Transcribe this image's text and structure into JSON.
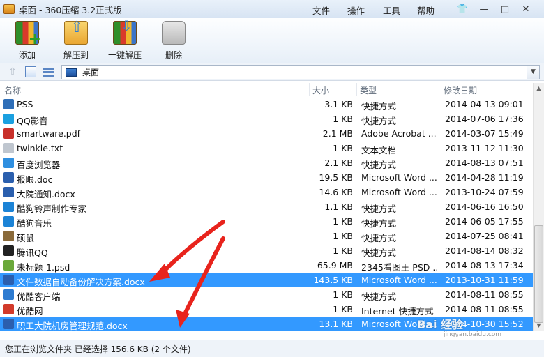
{
  "window": {
    "title": "桌面 - 360压缩 3.2正式版"
  },
  "menu": [
    "文件",
    "操作",
    "工具",
    "帮助"
  ],
  "window_controls": {
    "skin": "👕",
    "minimize": "—",
    "maximize": "□",
    "close": "✕"
  },
  "toolbar": {
    "add": "添加",
    "extract": "解压到",
    "one_click": "一键解压",
    "delete": "删除"
  },
  "address": {
    "current": "桌面",
    "back_glyph": "⇧",
    "dropdown_glyph": "▼"
  },
  "columns": {
    "name": "名称",
    "size": "大小",
    "type": "类型",
    "modified": "修改日期"
  },
  "files": [
    {
      "name": "PSS",
      "size": "3.1 KB",
      "type": "快捷方式",
      "modified": "2014-04-13 09:01",
      "icon": "pss-icon",
      "color": "#2f6fb8",
      "selected": false
    },
    {
      "name": "QQ影音",
      "size": "1 KB",
      "type": "快捷方式",
      "modified": "2014-07-06 17:36",
      "icon": "qqplayer-icon",
      "color": "#1aa0e0",
      "selected": false
    },
    {
      "name": "smartware.pdf",
      "size": "2.1 MB",
      "type": "Adobe Acrobat ...",
      "modified": "2014-03-07 15:49",
      "icon": "pdf-icon",
      "color": "#c8302a",
      "selected": false
    },
    {
      "name": "twinkle.txt",
      "size": "1 KB",
      "type": "文本文档",
      "modified": "2013-11-12 11:30",
      "icon": "text-file-icon",
      "color": "#bfc6cf",
      "selected": false
    },
    {
      "name": "百度浏览器",
      "size": "2.1 KB",
      "type": "快捷方式",
      "modified": "2014-08-13 07:51",
      "icon": "baidu-browser-icon",
      "color": "#2f8fe0",
      "selected": false
    },
    {
      "name": "报眼.doc",
      "size": "19.5 KB",
      "type": "Microsoft Word ...",
      "modified": "2014-04-28 11:19",
      "icon": "word-doc-icon",
      "color": "#2b5fae",
      "selected": false
    },
    {
      "name": "大院通知.docx",
      "size": "14.6 KB",
      "type": "Microsoft Word ...",
      "modified": "2013-10-24 07:59",
      "icon": "word-doc-icon",
      "color": "#2b5fae",
      "selected": false
    },
    {
      "name": "酷狗铃声制作专家",
      "size": "1.1 KB",
      "type": "快捷方式",
      "modified": "2014-06-16 16:50",
      "icon": "kugou-ringtone-icon",
      "color": "#1b83d6",
      "selected": false
    },
    {
      "name": "酷狗音乐",
      "size": "1 KB",
      "type": "快捷方式",
      "modified": "2014-06-05 17:55",
      "icon": "kugou-icon",
      "color": "#1b83d6",
      "selected": false
    },
    {
      "name": "硕鼠",
      "size": "1 KB",
      "type": "快捷方式",
      "modified": "2014-07-25 08:41",
      "icon": "shuoshu-icon",
      "color": "#8a6a3a",
      "selected": false
    },
    {
      "name": "腾讯QQ",
      "size": "1 KB",
      "type": "快捷方式",
      "modified": "2014-08-14 08:32",
      "icon": "qq-icon",
      "color": "#222222",
      "selected": false
    },
    {
      "name": "未标题-1.psd",
      "size": "65.9 MB",
      "type": "2345看图王 PSD ...",
      "modified": "2014-08-13 17:34",
      "icon": "psd-icon",
      "color": "#6aa83a",
      "selected": false
    },
    {
      "name": "文件数据自动备份解决方案.docx",
      "size": "143.5 KB",
      "type": "Microsoft Word ...",
      "modified": "2013-10-31 11:59",
      "icon": "word-doc-icon",
      "color": "#2b5fae",
      "selected": true
    },
    {
      "name": "优酷客户端",
      "size": "1 KB",
      "type": "快捷方式",
      "modified": "2014-08-11 08:55",
      "icon": "youku-client-icon",
      "color": "#2d7bd1",
      "selected": false
    },
    {
      "name": "优酷网",
      "size": "1 KB",
      "type": "Internet 快捷方式",
      "modified": "2014-08-11 08:55",
      "icon": "youku-web-icon",
      "color": "#d23a2a",
      "selected": false
    },
    {
      "name": "职工大院机房管理规范.docx",
      "size": "13.1 KB",
      "type": "Microsoft Word ...",
      "modified": "2014-10-30 15:52",
      "icon": "word-doc-icon",
      "color": "#2b5fae",
      "selected": true
    }
  ],
  "scrollbar": {
    "up": "▲",
    "down": "▼"
  },
  "status": {
    "text": "您正在浏览文件夹 已经选择 156.6 KB (2 个文件)"
  },
  "watermark": {
    "brand": "Bai 经验",
    "url": "jingyan.baidu.com"
  },
  "colors": {
    "selection": "#3399ff",
    "annotation_arrow": "#e8231c"
  }
}
